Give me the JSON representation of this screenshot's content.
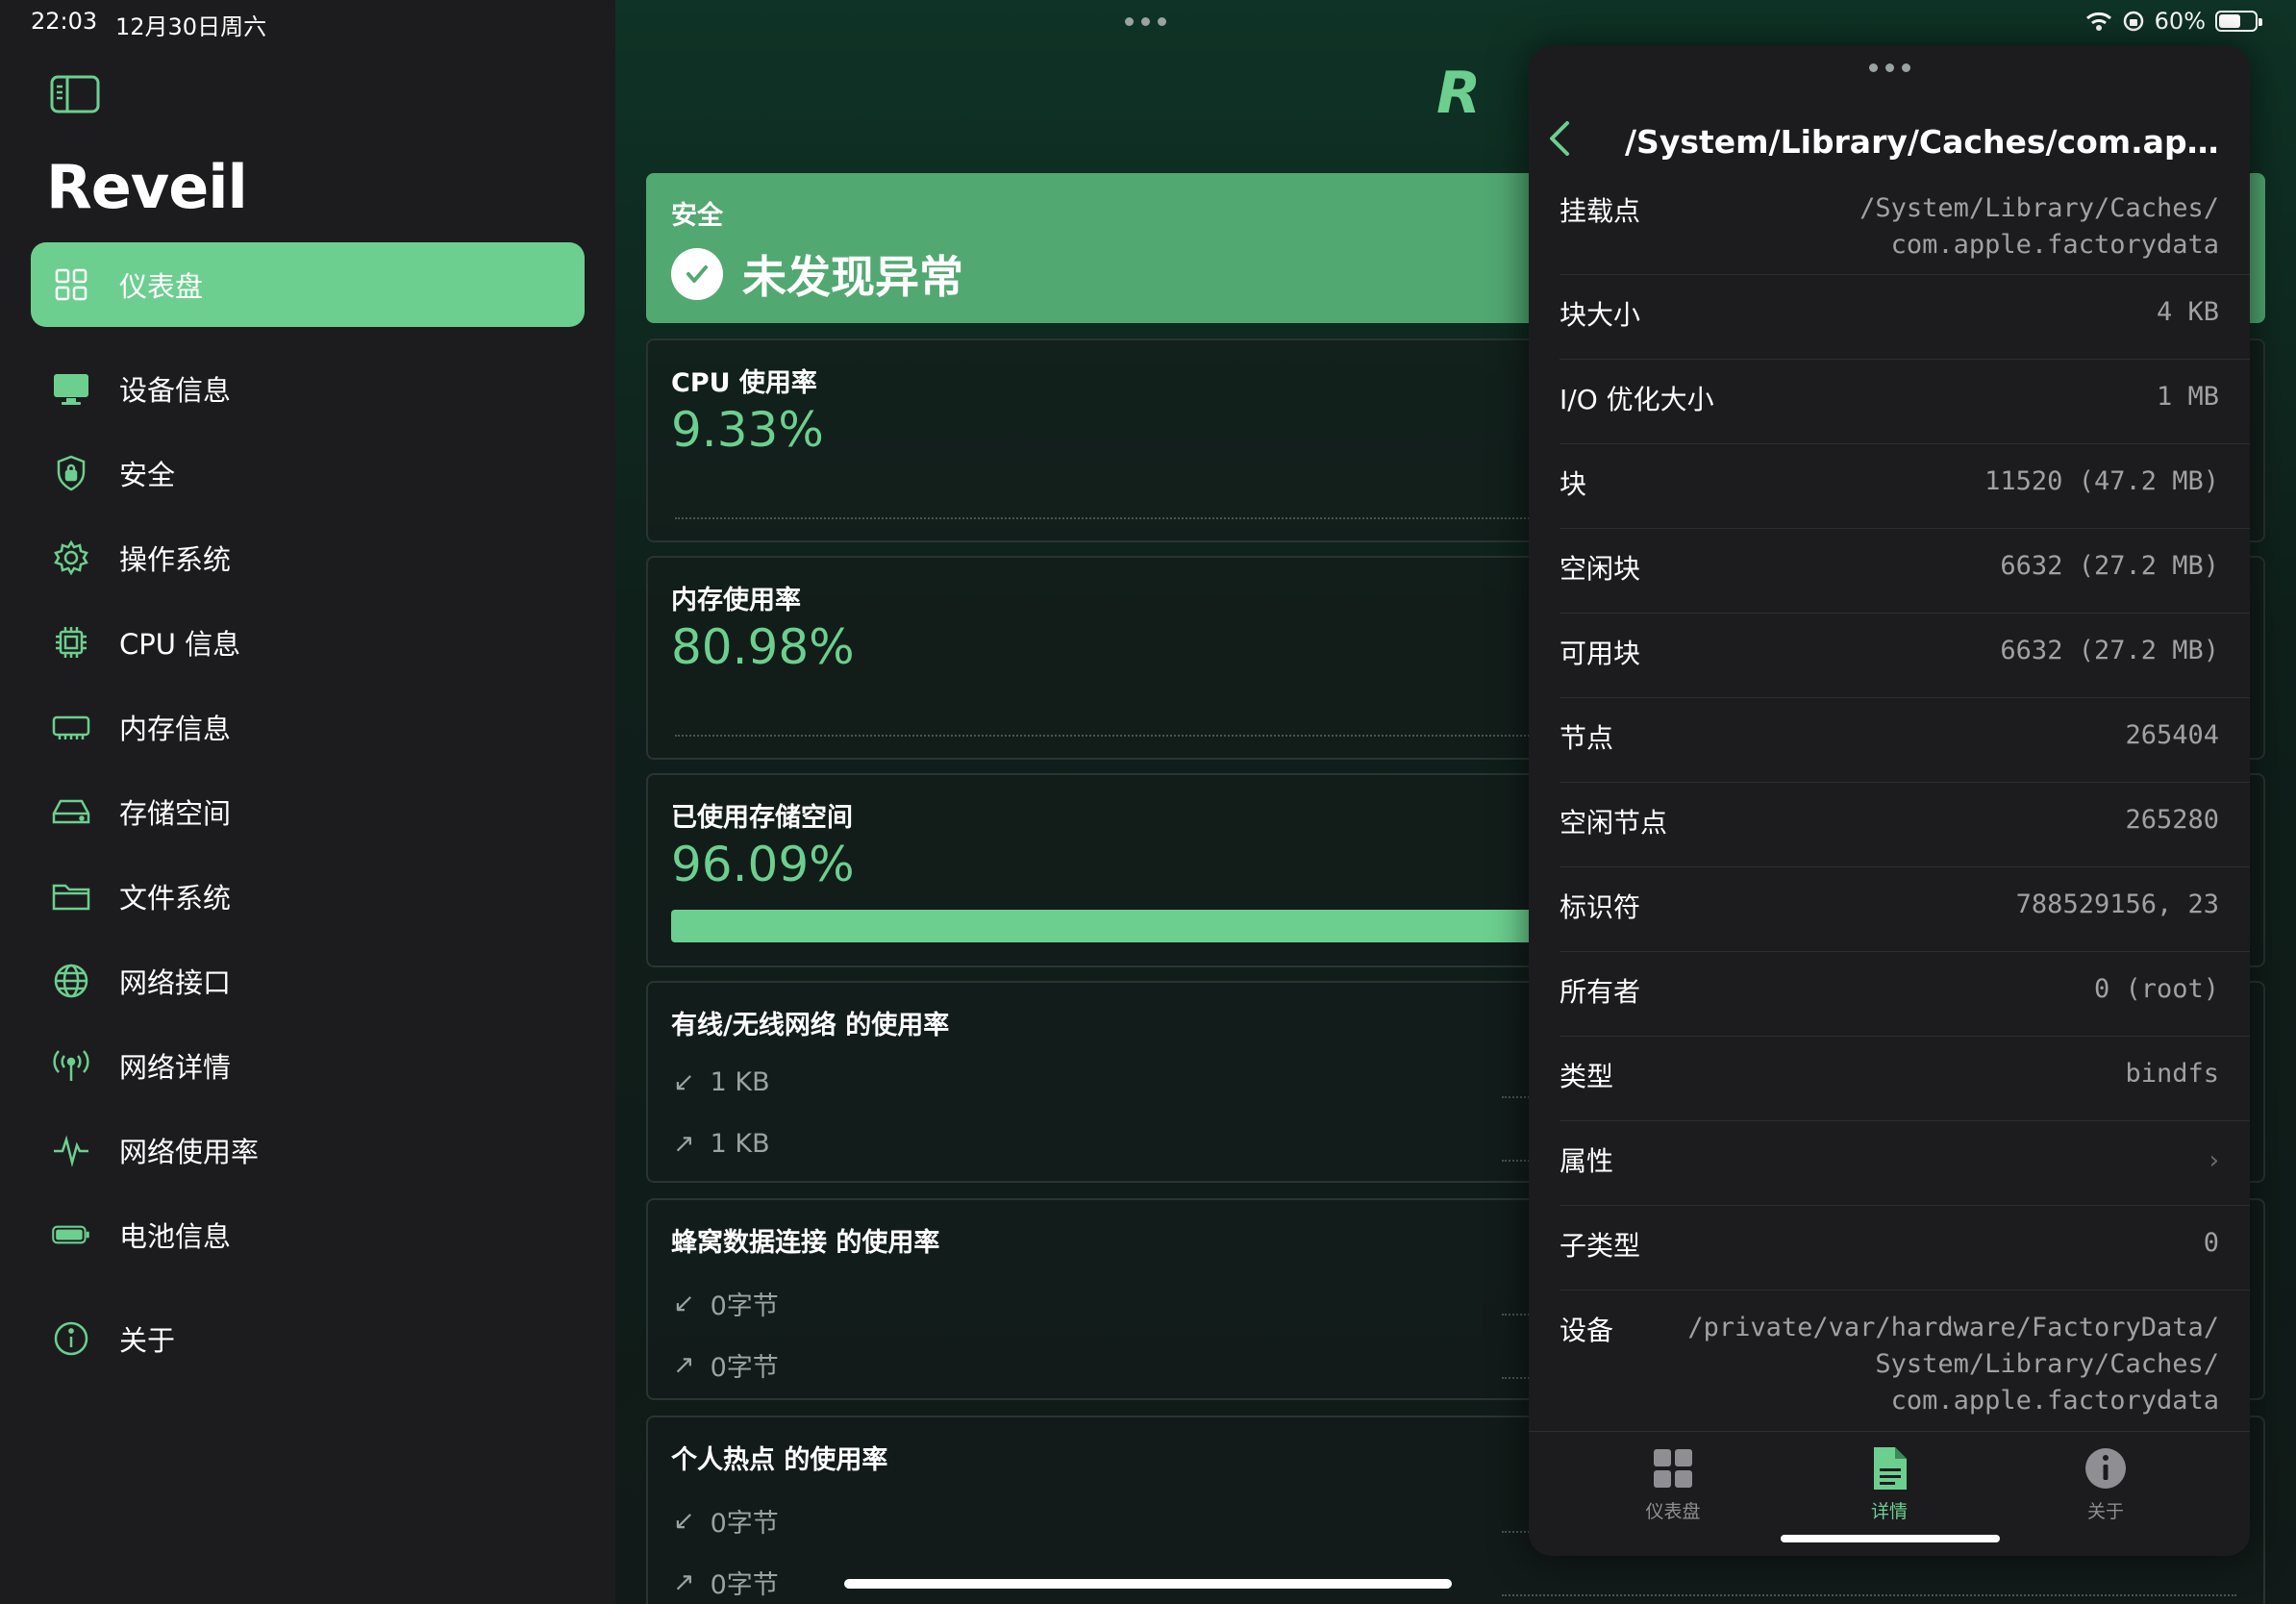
{
  "status_bar": {
    "time": "22:03",
    "date": "12月30日周六",
    "battery": "60%",
    "battery_level": 0.6
  },
  "sidebar": {
    "app_title": "Reveil",
    "items": [
      {
        "label": "仪表盘",
        "icon": "dashboard-icon",
        "active": true
      },
      {
        "label": "设备信息",
        "icon": "monitor-icon"
      },
      {
        "label": "安全",
        "icon": "shield-icon"
      },
      {
        "label": "操作系统",
        "icon": "gear-icon"
      },
      {
        "label": "CPU 信息",
        "icon": "cpu-icon"
      },
      {
        "label": "内存信息",
        "icon": "memory-icon"
      },
      {
        "label": "存储空间",
        "icon": "drive-icon"
      },
      {
        "label": "文件系统",
        "icon": "folder-icon"
      },
      {
        "label": "网络接口",
        "icon": "globe-icon"
      },
      {
        "label": "网络详情",
        "icon": "antenna-icon"
      },
      {
        "label": "网络使用率",
        "icon": "waveform-icon"
      },
      {
        "label": "电池信息",
        "icon": "battery-icon"
      },
      {
        "label": "关于",
        "icon": "info-icon"
      }
    ]
  },
  "main": {
    "logo": "R",
    "safety": {
      "label": "安全",
      "status": "未发现异常"
    },
    "cpu": {
      "title": "CPU 使用率",
      "value": "9.33%"
    },
    "memory": {
      "title": "内存使用率",
      "value": "80.98%"
    },
    "storage": {
      "title": "已使用存储空间",
      "value": "96.09%",
      "level": 0.9609
    },
    "wired": {
      "title": "有线/无线网络 的使用率",
      "down": "1 KB",
      "up": "1 KB"
    },
    "cellular": {
      "title": "蜂窝数据连接 的使用率",
      "down": "0字节",
      "up": "0字节"
    },
    "hotspot": {
      "title": "个人热点 的使用率",
      "down": "0字节",
      "up": "0字节"
    }
  },
  "detail": {
    "title": "/System/Library/Caches/com.apple.f...",
    "rows": [
      {
        "label": "挂载点",
        "value_lines": [
          "/System/Library/Caches/",
          "com.apple.factorydata"
        ]
      },
      {
        "label": "块大小",
        "value_lines": [
          "4 KB"
        ]
      },
      {
        "label": "I/O 优化大小",
        "value_lines": [
          "1 MB"
        ]
      },
      {
        "label": "块",
        "value_lines": [
          "11520 (47.2 MB)"
        ]
      },
      {
        "label": "空闲块",
        "value_lines": [
          "6632 (27.2 MB)"
        ]
      },
      {
        "label": "可用块",
        "value_lines": [
          "6632 (27.2 MB)"
        ]
      },
      {
        "label": "节点",
        "value_lines": [
          "265404"
        ]
      },
      {
        "label": "空闲节点",
        "value_lines": [
          "265280"
        ]
      },
      {
        "label": "标识符",
        "value_lines": [
          "788529156, 23"
        ]
      },
      {
        "label": "所有者",
        "value_lines": [
          "0 (root)"
        ]
      },
      {
        "label": "类型",
        "value_lines": [
          "bindfs"
        ]
      },
      {
        "label": "属性",
        "value_lines": [],
        "chevron": true
      },
      {
        "label": "子类型",
        "value_lines": [
          "0"
        ]
      },
      {
        "label": "设备",
        "value_lines": [
          "/private/var/hardware/FactoryData/",
          "System/Library/Caches/",
          "com.apple.factorydata"
        ]
      }
    ],
    "tabs": [
      {
        "label": "仪表盘",
        "icon": "grid-icon"
      },
      {
        "label": "详情",
        "icon": "document-icon",
        "active": true
      },
      {
        "label": "关于",
        "icon": "info-icon"
      }
    ]
  },
  "colors": {
    "accent": "#6ccf8f",
    "safe_card": "#52a871",
    "sidebar_bg": "#1c1c1e"
  }
}
